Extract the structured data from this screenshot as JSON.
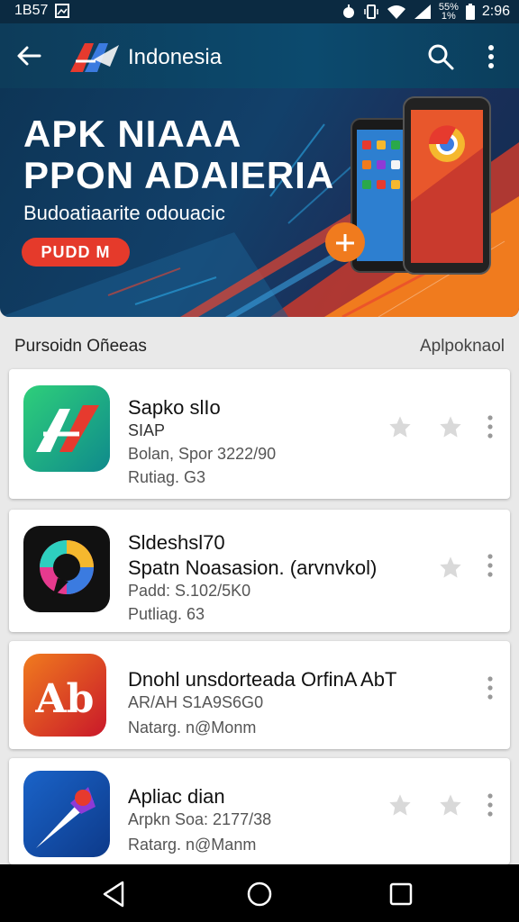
{
  "status_bar": {
    "left_text": "1B57",
    "battery_text_line1": "55%",
    "battery_text_line2": "1%",
    "time": "2:96"
  },
  "app_bar": {
    "title": "Indonesia"
  },
  "banner": {
    "headline_line1": "APK NIAAA",
    "headline_line2": "PPON ADAIERIA",
    "subtitle": "Budoatiaarite odouacic",
    "button_label": "PUDD M"
  },
  "section": {
    "left_label": "Pursoidn Oñeeas",
    "right_label": "Aplpoknaol"
  },
  "apps": [
    {
      "title": "Sapko slIo",
      "line2": "SIAP",
      "line3": "Bolan, Spor 3222/90",
      "line4": "Rutiag. G3"
    },
    {
      "title": "Sldeshsl70",
      "line2": "Spatn Noasasion. (arvnvkol)",
      "line3": "Padd: S.102/5K0",
      "line4": "Putliag. 63"
    },
    {
      "title": "Dnohl unsdorteada OrfinA AbT",
      "line2": "AR/AH S1A9S6G0",
      "line3": "Natarg. n@Monm"
    },
    {
      "title": "Apliac dian",
      "line2": "Arpkn Soa: 2177/38",
      "line3": "Ratarg. n@Manm"
    }
  ],
  "colors": {
    "status_bar": "#0b2a41",
    "app_bar": "#0c4a6e",
    "banner_button": "#e53a2b",
    "accent_orange": "#f07b1e"
  }
}
